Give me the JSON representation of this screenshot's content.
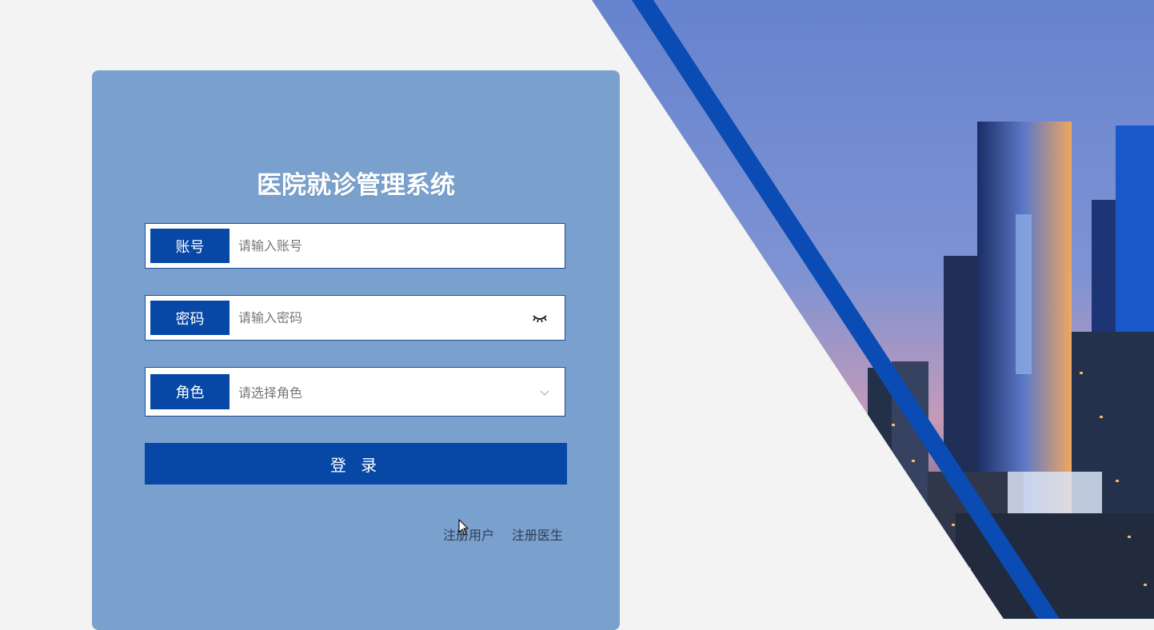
{
  "title": "医院就诊管理系统",
  "form": {
    "account": {
      "label": "账号",
      "placeholder": "请输入账号"
    },
    "password": {
      "label": "密码",
      "placeholder": "请输入密码",
      "toggle_icon": "eye-closed-icon"
    },
    "role": {
      "label": "角色",
      "placeholder": "请选择角色",
      "dropdown_icon": "chevron-down-icon"
    },
    "login_button": "登 录"
  },
  "links": {
    "register_user": "注册用户",
    "register_doctor": "注册医生"
  },
  "colors": {
    "accent": "#0747a6",
    "card": "#7aa0cd",
    "background": "#f3f3f4"
  }
}
